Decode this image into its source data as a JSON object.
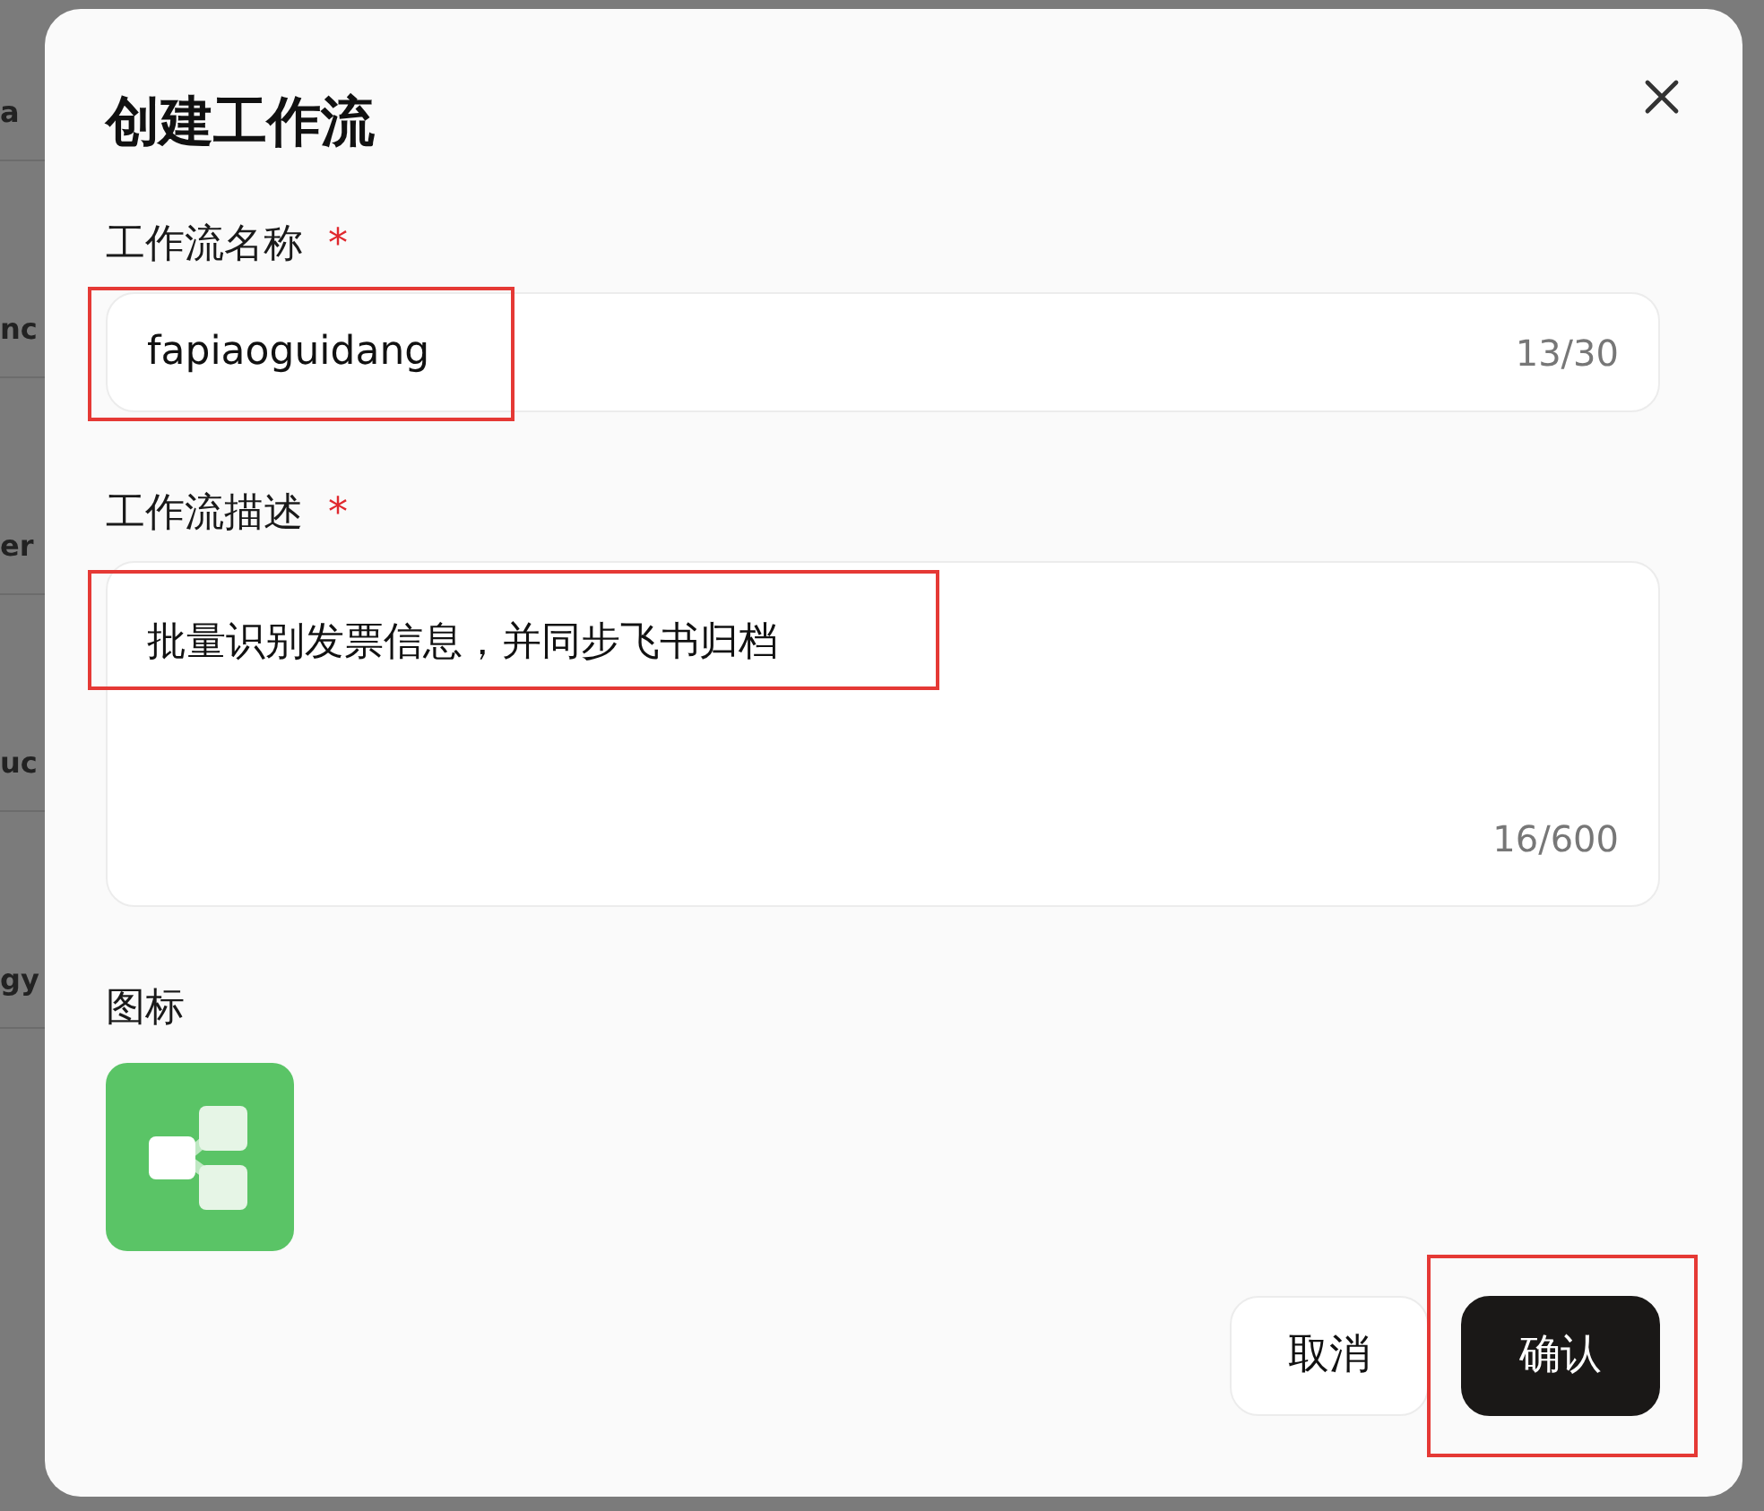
{
  "background_list": [
    {
      "title": "a"
    },
    {
      "title": "nc"
    },
    {
      "title": "er"
    },
    {
      "title": "uc"
    },
    {
      "title": "gy"
    }
  ],
  "dialog": {
    "title": "创建工作流",
    "fields": [
      {
        "kind": "input",
        "label": "工作流名称",
        "required_mark": "*",
        "value": "fapiaoguidang",
        "counter": "13/30",
        "highlighted": true
      },
      {
        "kind": "textarea",
        "label": "工作流描述",
        "required_mark": "*",
        "value": "批量识别发票信息，并同步飞书归档",
        "counter": "16/600",
        "highlighted": true
      }
    ],
    "icon_label": "图标",
    "buttons": [
      {
        "kind": "secondary",
        "label": "取消",
        "highlighted": false
      },
      {
        "kind": "primary",
        "label": "确认",
        "highlighted": true
      }
    ]
  }
}
